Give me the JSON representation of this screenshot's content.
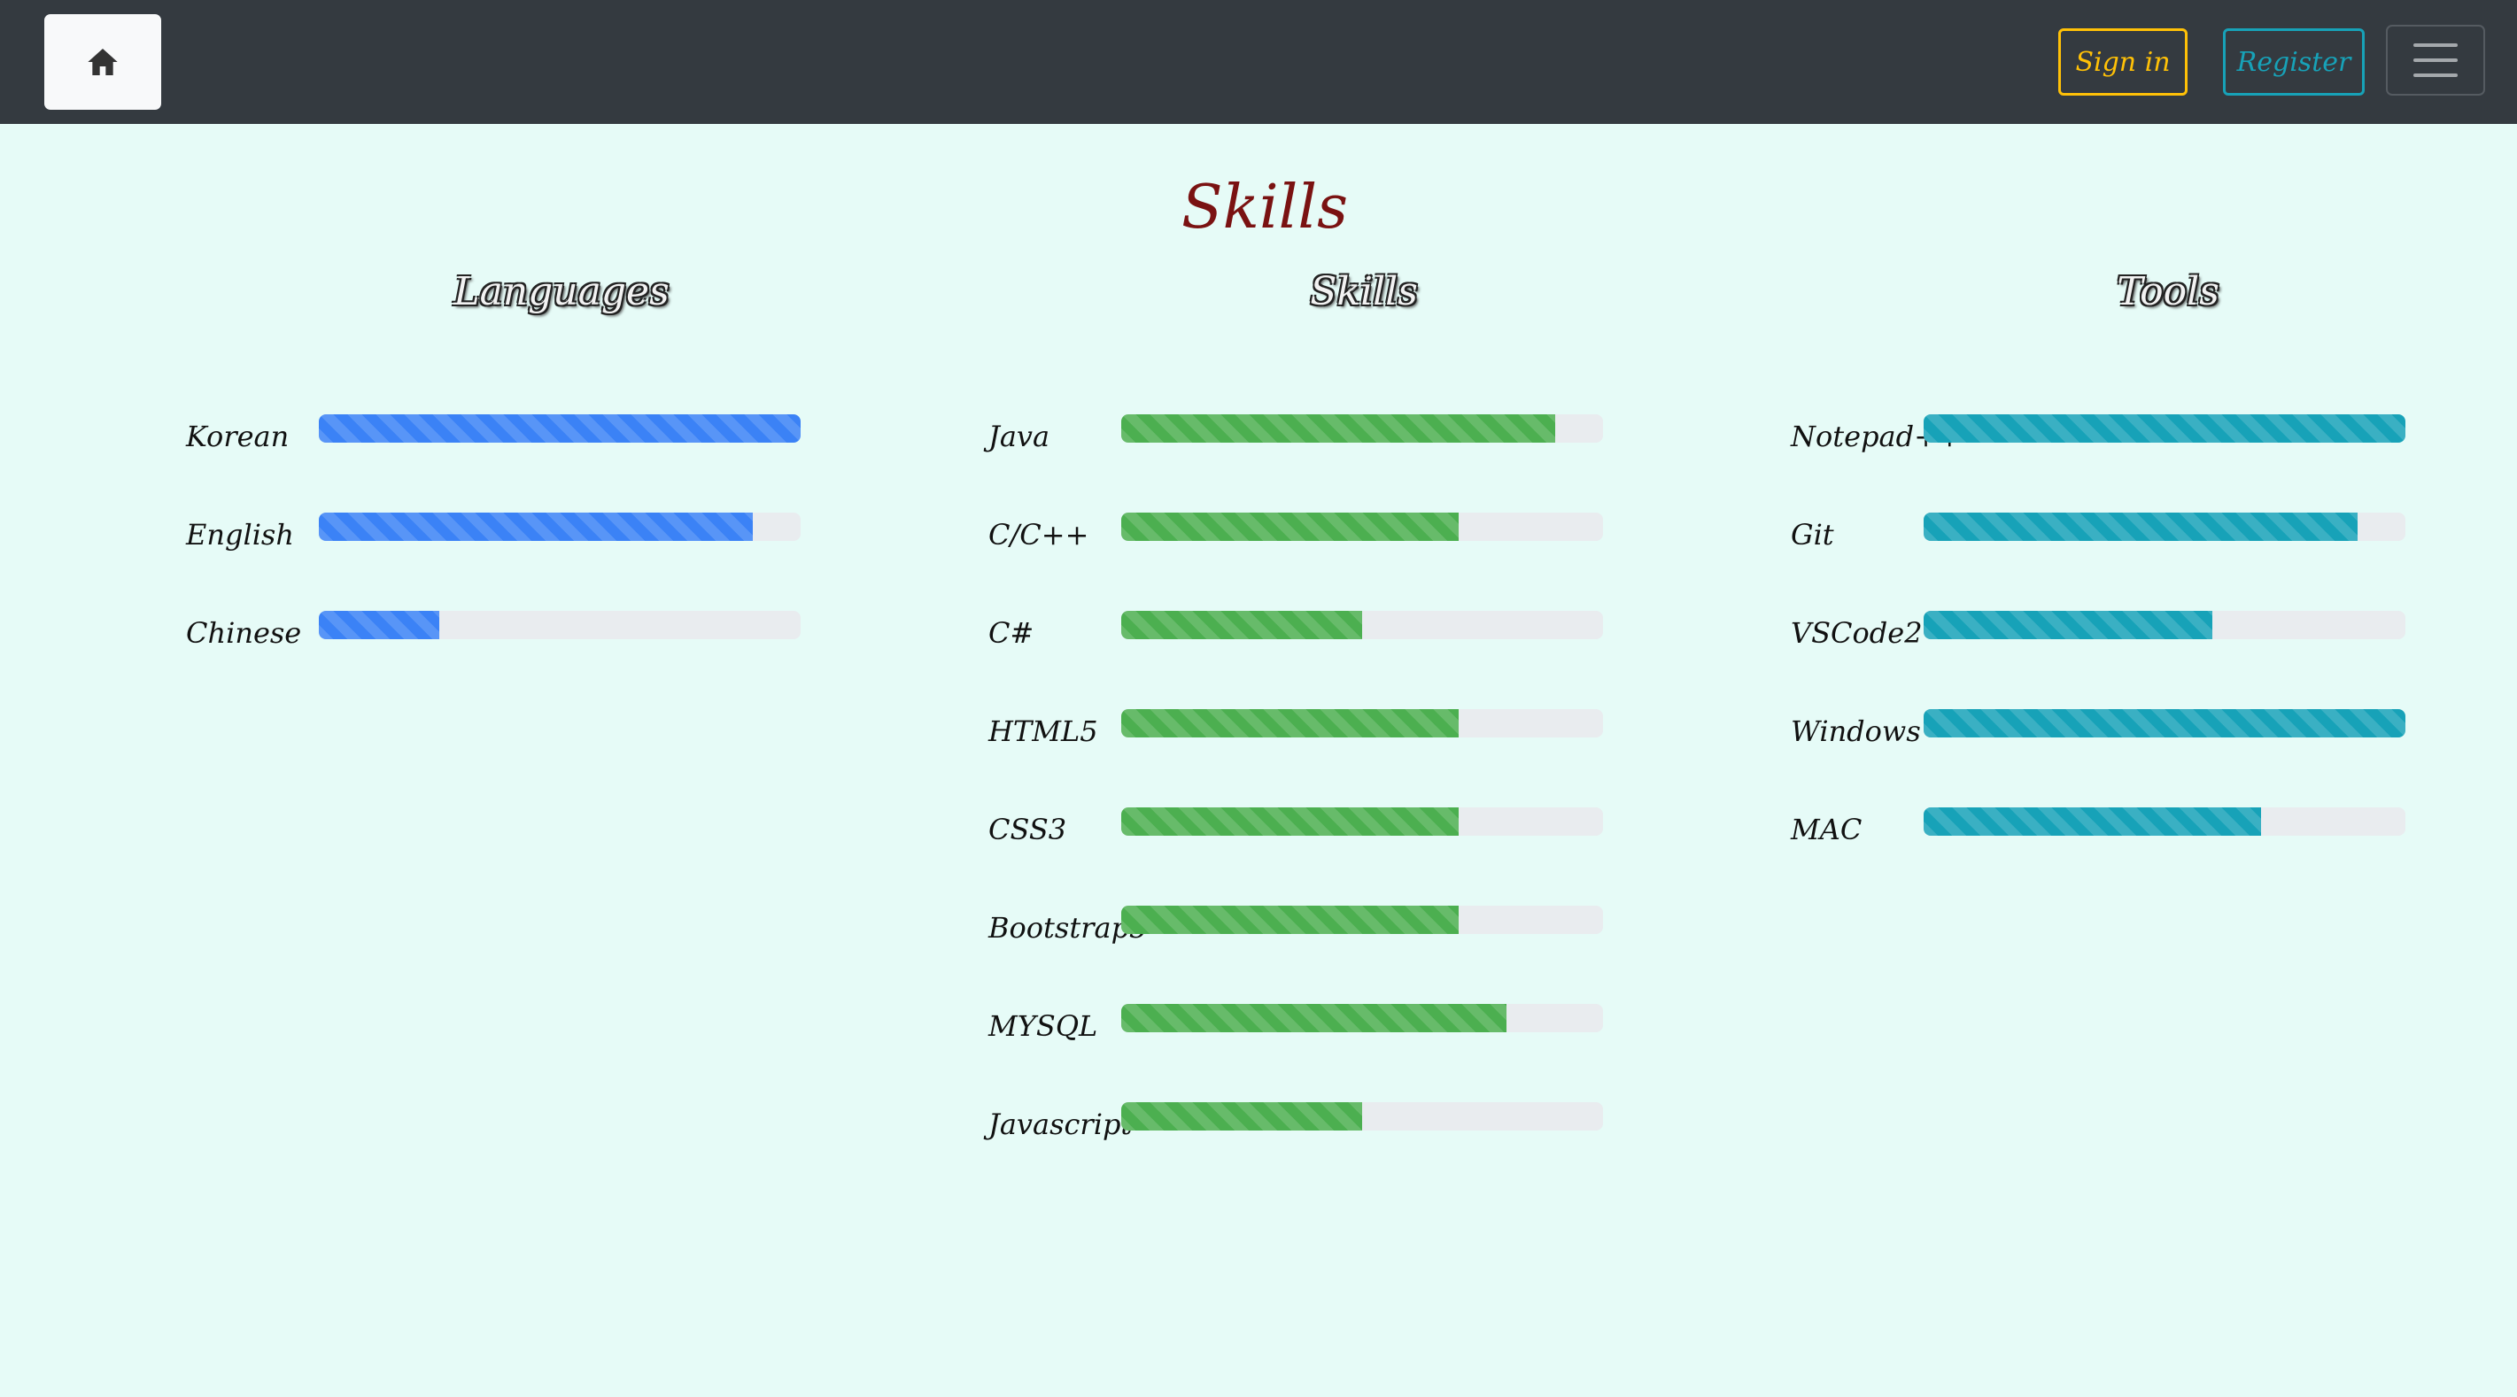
{
  "nav": {
    "home_icon": "home-icon",
    "signin_label": "Sign in",
    "register_label": "Register",
    "menu_icon": "hamburger-menu-icon"
  },
  "page": {
    "title": "Skills"
  },
  "columns": [
    {
      "title": "Languages",
      "color": "#3b82f6",
      "items": [
        {
          "label": "Korean",
          "value": 100
        },
        {
          "label": "English",
          "value": 90
        },
        {
          "label": "Chinese",
          "value": 25
        }
      ]
    },
    {
      "title": "Skills",
      "color": "#4caf50",
      "items": [
        {
          "label": "Java",
          "value": 90
        },
        {
          "label": "C/C++",
          "value": 70
        },
        {
          "label": "C#",
          "value": 50
        },
        {
          "label": "HTML5",
          "value": 70
        },
        {
          "label": "CSS3",
          "value": 70
        },
        {
          "label": "Bootstrap5",
          "value": 70
        },
        {
          "label": "MYSQL",
          "value": 80
        },
        {
          "label": "Javascript",
          "value": 50
        }
      ]
    },
    {
      "title": "Tools",
      "color": "#17a2b8",
      "items": [
        {
          "label": "Notepad++",
          "value": 100
        },
        {
          "label": "Git",
          "value": 90
        },
        {
          "label": "VSCode2",
          "value": 60
        },
        {
          "label": "Windows",
          "value": 100
        },
        {
          "label": "MAC",
          "value": 70
        }
      ]
    }
  ]
}
